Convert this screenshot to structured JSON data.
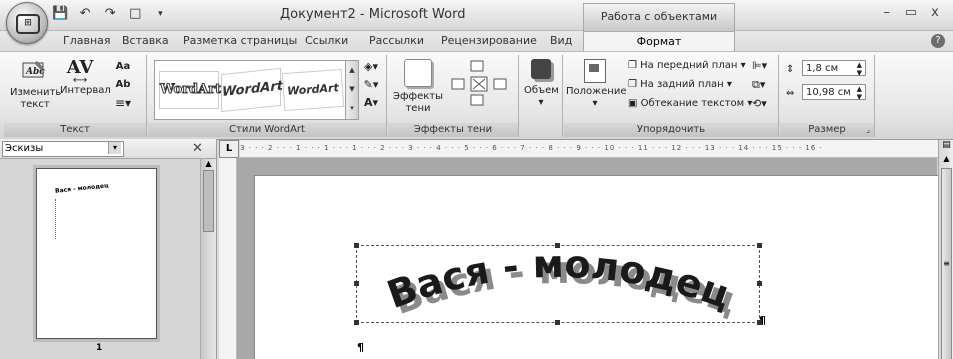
{
  "window": {
    "title": "Документ2 - Microsoft Word",
    "context_tab_header": "Работа с объектами WordArt",
    "controls": [
      "–",
      "▭",
      "x"
    ]
  },
  "tabs": [
    "Главная",
    "Вставка",
    "Разметка страницы",
    "Ссылки",
    "Рассылки",
    "Рецензирование",
    "Вид",
    "Формат"
  ],
  "active_tab": "Формат",
  "ribbon": {
    "text_group": {
      "label": "Текст",
      "edit_text": "Изменить текст",
      "spacing": "Интервал",
      "spacing_icon_text": "AV",
      "small1": "Aa",
      "small2": "Ab"
    },
    "styles_group": {
      "label": "Стили WordArt",
      "items": [
        "WordArt",
        "WordArt",
        "WordArt"
      ]
    },
    "shadow_group": {
      "label": "Эффекты тени",
      "effects": "Эффекты тени"
    },
    "volume_group": {
      "label": "Объем",
      "button": "Объем"
    },
    "arrange_group": {
      "label": "Упорядочить",
      "position": "Положение",
      "front": "На передний план",
      "back": "На задний план",
      "wrap": "Обтекание текстом"
    },
    "size_group": {
      "label": "Размер",
      "height": "1,8 см",
      "width": "10,98 см"
    }
  },
  "pane": {
    "title": "Эскизы",
    "thumb_text": "Вася - молодец",
    "page_number": "1"
  },
  "ruler": {
    "corner": "L",
    "hruler_text": "3 · · · 2 · · · 1 · · · 1 · · · 1 · · · 2 · · · 3 · · · 4 · · · 5 · · · 6 · · · 7 · · · 8 · · · 9 · · · 10 · · · 11 · · · 12 · · · 13 · · · 14 · · · 15 · · · 16 ·"
  },
  "document": {
    "wordart_text": "Вася - молодец",
    "para_mark": "¶"
  },
  "colors": {
    "wordart_fill": "#1a1a1a",
    "wordart_shadow": "#8a8a8a"
  }
}
